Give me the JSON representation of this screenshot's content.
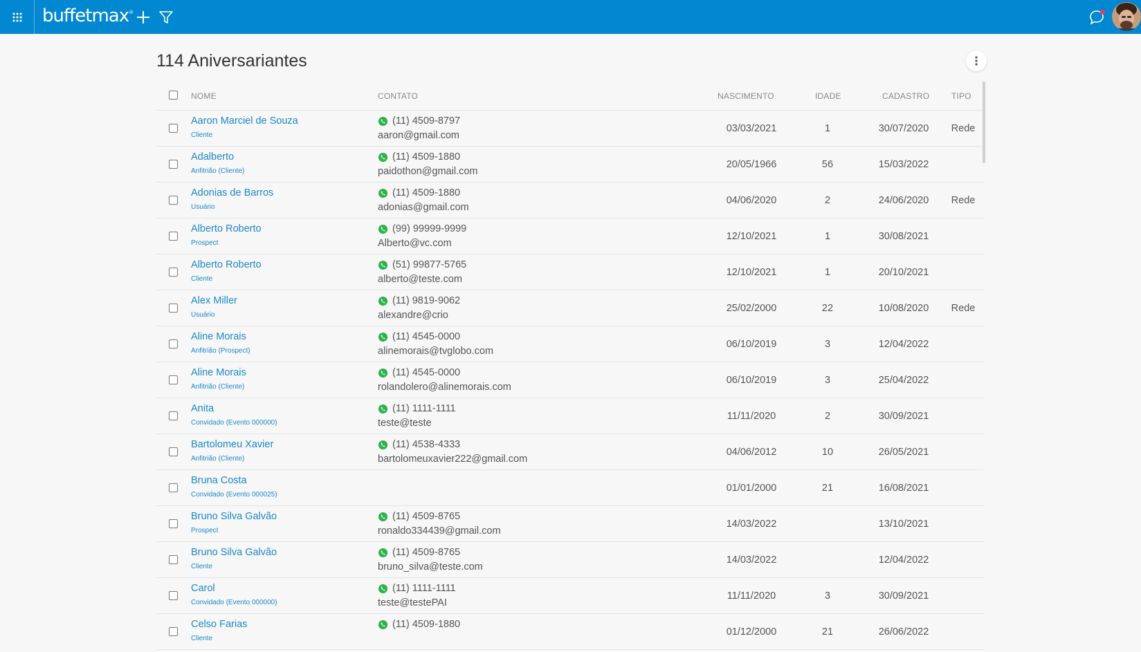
{
  "app": {
    "logo": "buffetmax",
    "logo_mark": "®"
  },
  "page": {
    "title": "114 Aniversariantes"
  },
  "table": {
    "headers": {
      "nome": "NOME",
      "contato": "CONTATO",
      "nascimento": "NASCIMENTO",
      "idade": "IDADE",
      "cadastro": "CADASTRO",
      "tipo": "TIPO"
    },
    "rows": [
      {
        "nome": "Aaron Marciel de Souza",
        "sub": "Cliente",
        "phone": "(11) 4509-8797",
        "email": "aaron@gmail.com",
        "nascimento": "03/03/2021",
        "idade": "1",
        "cadastro": "30/07/2020",
        "tipo": "Rede"
      },
      {
        "nome": "Adalberto",
        "sub": "Anfitrião (Cliente)",
        "phone": "(11) 4509-1880",
        "email": "paidothon@gmail.com",
        "nascimento": "20/05/1966",
        "idade": "56",
        "cadastro": "15/03/2022",
        "tipo": ""
      },
      {
        "nome": "Adonias de Barros",
        "sub": "Usuário",
        "phone": "(11) 4509-1880",
        "email": "adonias@gmail.com",
        "nascimento": "04/06/2020",
        "idade": "2",
        "cadastro": "24/06/2020",
        "tipo": "Rede"
      },
      {
        "nome": "Alberto Roberto",
        "sub": "Prospect",
        "phone": "(99) 99999-9999",
        "email": "Alberto@vc.com",
        "nascimento": "12/10/2021",
        "idade": "1",
        "cadastro": "30/08/2021",
        "tipo": ""
      },
      {
        "nome": "Alberto Roberto",
        "sub": "Cliente",
        "phone": "(51) 99877-5765",
        "email": "alberto@teste.com",
        "nascimento": "12/10/2021",
        "idade": "1",
        "cadastro": "20/10/2021",
        "tipo": ""
      },
      {
        "nome": "Alex Miller",
        "sub": "Usuário",
        "phone": "(11) 9819-9062",
        "email": "alexandre@crio",
        "nascimento": "25/02/2000",
        "idade": "22",
        "cadastro": "10/08/2020",
        "tipo": "Rede"
      },
      {
        "nome": "Aline Morais",
        "sub": "Anfitrião (Prospect)",
        "phone": "(11) 4545-0000",
        "email": "alinemorais@tvglobo.com",
        "nascimento": "06/10/2019",
        "idade": "3",
        "cadastro": "12/04/2022",
        "tipo": ""
      },
      {
        "nome": "Aline Morais",
        "sub": "Anfitrião (Cliente)",
        "phone": "(11) 4545-0000",
        "email": "rolandolero@alinemorais.com",
        "nascimento": "06/10/2019",
        "idade": "3",
        "cadastro": "25/04/2022",
        "tipo": ""
      },
      {
        "nome": "Anita",
        "sub": "Convidado (Evento 000000)",
        "phone": "(11) 1111-1111",
        "email": "teste@teste",
        "nascimento": "11/11/2020",
        "idade": "2",
        "cadastro": "30/09/2021",
        "tipo": ""
      },
      {
        "nome": "Bartolomeu Xavier",
        "sub": "Anfitrião (Cliente)",
        "phone": "(11) 4538-4333",
        "email": "bartolomeuxavier222@gmail.com",
        "nascimento": "04/06/2012",
        "idade": "10",
        "cadastro": "26/05/2021",
        "tipo": ""
      },
      {
        "nome": "Bruna Costa",
        "sub": "Convidado (Evento 000025)",
        "phone": "",
        "email": "",
        "nascimento": "01/01/2000",
        "idade": "21",
        "cadastro": "16/08/2021",
        "tipo": ""
      },
      {
        "nome": "Bruno Silva Galvão",
        "sub": "Prospect",
        "phone": "(11) 4509-8765",
        "email": "ronaldo334439@gmail.com",
        "nascimento": "14/03/2022",
        "idade": "",
        "cadastro": "13/10/2021",
        "tipo": ""
      },
      {
        "nome": "Bruno Silva Galvão",
        "sub": "Cliente",
        "phone": "(11) 4509-8765",
        "email": "bruno_silva@teste.com",
        "nascimento": "14/03/2022",
        "idade": "",
        "cadastro": "12/04/2022",
        "tipo": ""
      },
      {
        "nome": "Carol",
        "sub": "Convidado (Evento 000000)",
        "phone": "(11) 1111-1111",
        "email": "teste@testePAI",
        "nascimento": "11/11/2020",
        "idade": "3",
        "cadastro": "30/09/2021",
        "tipo": ""
      },
      {
        "nome": "Celso Farias",
        "sub": "Cliente",
        "phone": "(11) 4509-1880",
        "email": "",
        "nascimento": "01/12/2000",
        "idade": "21",
        "cadastro": "26/06/2022",
        "tipo": ""
      }
    ]
  },
  "icons": {
    "apps": "apps-grid-icon",
    "add": "plus-icon",
    "filter": "filter-icon",
    "chat": "chat-bubble-icon",
    "more": "more-vertical-icon",
    "whatsapp": "whatsapp-icon"
  },
  "colors": {
    "topbar": "#0288d1",
    "link": "#1b87c9",
    "whatsapp": "#2fb24b",
    "notification": "#ef3b5a"
  }
}
